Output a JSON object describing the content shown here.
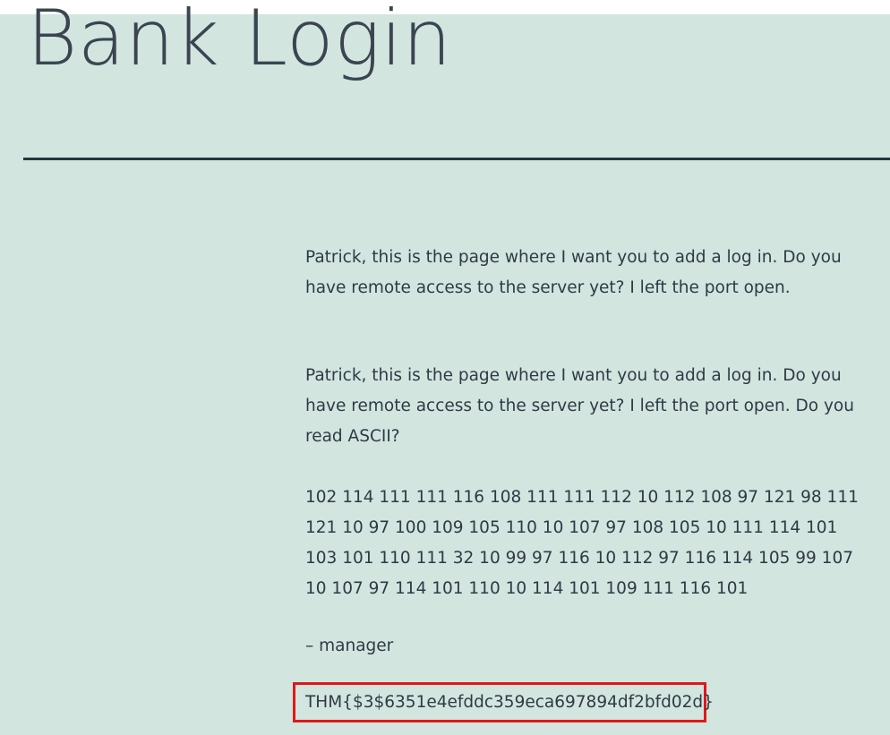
{
  "page": {
    "title": "Bank Login"
  },
  "article": {
    "paragraphs": [
      "Patrick, this is the page where I want you to add a log in. Do you have remote access to the server yet? I left the port open.",
      "Patrick, this is the page where I want you to add a log in. Do you have remote access to the server yet? I left the port open. Do you read ASCII?",
      "102 114 111 111 116 108 111 111 112 10 112 108 97 121 98 111 121 10 97 100 109 105 110 10 107 97 108 105 10 111 114 101 103 101 110 111 32 10 99 97 116 10 112 97 116 114 105 99 107 10 107 97 114 101 110 10 114 101 109 111 116 101",
      "– manager"
    ],
    "flag": "THM{$3$6351e4efddc359eca697894df2bfd02d}"
  },
  "colors": {
    "background": "#d2e5df",
    "text": "#2f3a45",
    "highlight_border": "#e01818"
  }
}
